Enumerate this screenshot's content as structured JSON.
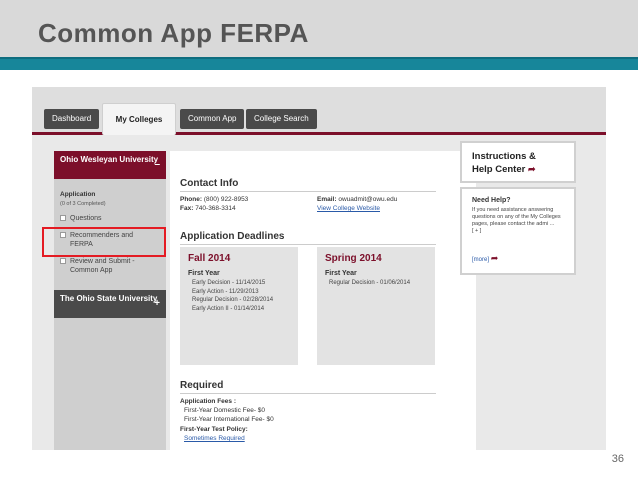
{
  "slide": {
    "title": "Common App FERPA",
    "page_number": "36"
  },
  "tabs": [
    {
      "label": "Dashboard",
      "active": false
    },
    {
      "label": "My Colleges",
      "active": true
    },
    {
      "label": "Common App",
      "active": false
    },
    {
      "label": "College Search",
      "active": false
    }
  ],
  "sidebar": {
    "college1": {
      "name": "Ohio Wesleyan University",
      "toggle": "–"
    },
    "application_label": "Application",
    "progress": "(0 of 3 Completed)",
    "items": [
      {
        "label": "Questions"
      },
      {
        "label": "Recommenders and FERPA"
      },
      {
        "label": "Review and Submit - Common App"
      }
    ],
    "college2": {
      "name": "The Ohio State University",
      "toggle": "+"
    }
  },
  "contact": {
    "title": "Contact Info",
    "phone_label": "Phone:",
    "phone": "(800) 922-8953",
    "fax_label": "Fax:",
    "fax": "740-368-3314",
    "email_label": "Email:",
    "email": "owuadmit@owu.edu",
    "website_link": "View College Website"
  },
  "deadlines": {
    "title": "Application Deadlines",
    "fall": {
      "term": "Fall 2014",
      "subtitle": "First Year",
      "lines": [
        "Early Decision - 11/14/2015",
        "Early Action - 11/29/2013",
        "Regular Decision - 02/28/2014",
        "Early Action II - 01/14/2014"
      ]
    },
    "spring": {
      "term": "Spring 2014",
      "subtitle": "First Year",
      "lines": [
        "Regular Decision - 01/06/2014"
      ]
    }
  },
  "required": {
    "title": "Required",
    "fees_label": "Application Fees :",
    "fee1": "First-Year Domestic Fee- $0",
    "fee2": "First-Year International Fee- $0",
    "test_policy_label": "First-Year Test Policy:",
    "test_policy_link": "Sometimes Required"
  },
  "help": {
    "title_line1": "Instructions &",
    "title_line2": "Help Center",
    "need_help": "Need Help?",
    "body": "If you need assistance answering questions on any of the My Colleges pages, please contact the admi ...",
    "expand": "[ + ]",
    "more": "[more]"
  },
  "colors": {
    "maroon": "#7c0f2a",
    "teal": "#17869a",
    "highlight_red": "#e41b23"
  }
}
